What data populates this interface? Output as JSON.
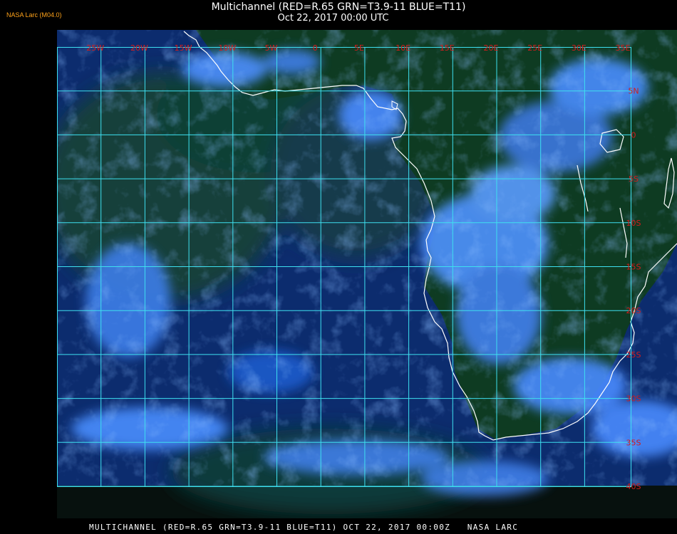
{
  "header": {
    "corner_label": "NASA Larc (M04.0)",
    "title": "Multichannel (RED=R.65 GRN=T3.9-11 BLUE=T11)",
    "datetime": "Oct 22, 2017 00:00 UTC"
  },
  "map": {
    "longitude_labels": [
      "25W",
      "20W",
      "15W",
      "10W",
      "5W",
      "0",
      "5E",
      "10E",
      "15E",
      "20E",
      "25E",
      "30E",
      "35E"
    ],
    "latitude_labels": [
      "5N",
      "0",
      "5S",
      "10S",
      "15S",
      "20S",
      "25S",
      "30S",
      "35S",
      "40S"
    ],
    "colors": {
      "grid": "#3ee0f0",
      "coast": "#ffffff",
      "label": "#d41c1c",
      "ocean": "#0d2a66",
      "land": "#0d3a1e",
      "cloud": "#4a8cff"
    }
  },
  "footer": {
    "caption": "MULTICHANNEL (RED=R.65 GRN=T3.9-11 BLUE=T11) OCT 22, 2017 00:00Z   NASA LARC"
  }
}
